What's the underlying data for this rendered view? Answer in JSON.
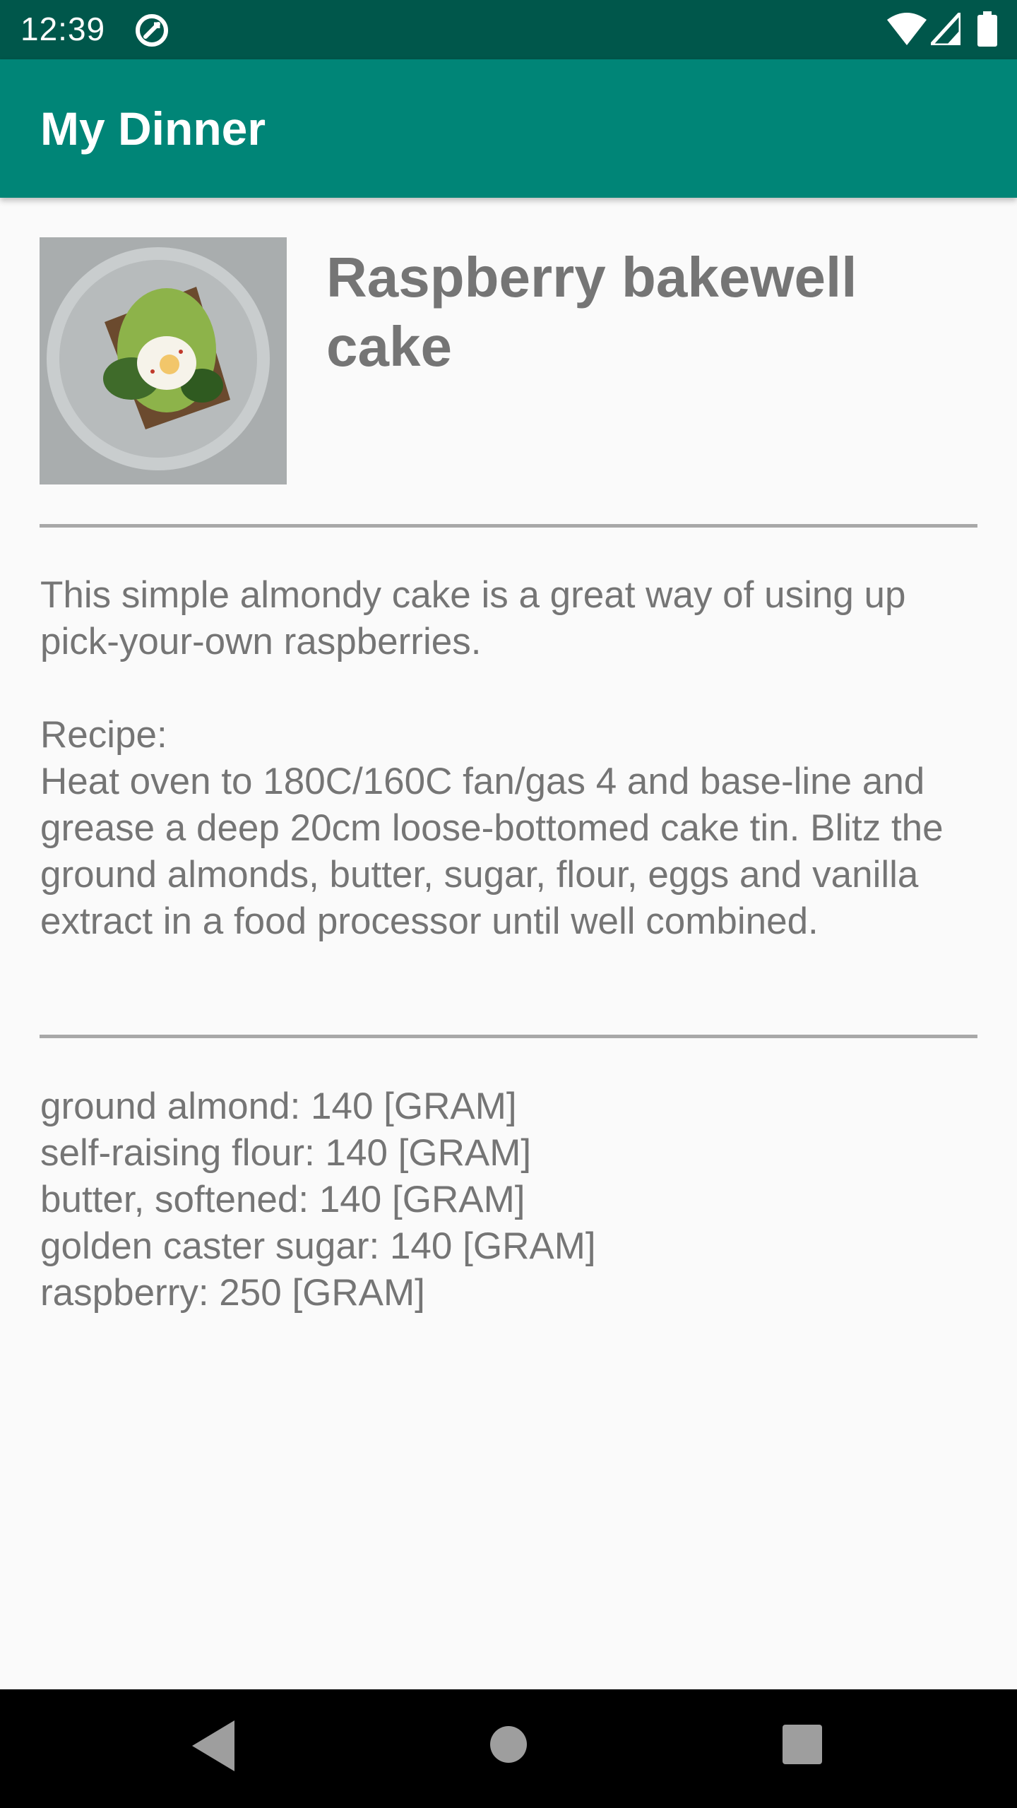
{
  "status_bar": {
    "time": "12:39",
    "icons": [
      "app-notification-icon",
      "wifi-icon",
      "signal-icon",
      "battery-icon"
    ]
  },
  "app_bar": {
    "title": "My Dinner",
    "color": "#008577",
    "status_color": "#00574b"
  },
  "recipe": {
    "image_icon": "food-photo",
    "title": "Raspberry bakewell cake",
    "description": "This simple almondy cake is a great way of using up pick-your-own raspberries.\n\nRecipe:\nHeat oven to 180C/160C fan/gas 4 and base-line and grease a deep 20cm loose-bottomed cake tin. Blitz the ground almonds, butter, sugar, flour, eggs and vanilla extract in a food processor until well combined.",
    "ingredients": [
      "ground almond: 140 [GRAM]",
      "self-raising flour: 140 [GRAM]",
      "butter, softened: 140 [GRAM]",
      "golden caster sugar: 140 [GRAM]",
      "raspberry: 250 [GRAM]"
    ]
  },
  "nav_bar": {
    "icons": [
      "back-icon",
      "home-icon",
      "recents-icon"
    ]
  }
}
